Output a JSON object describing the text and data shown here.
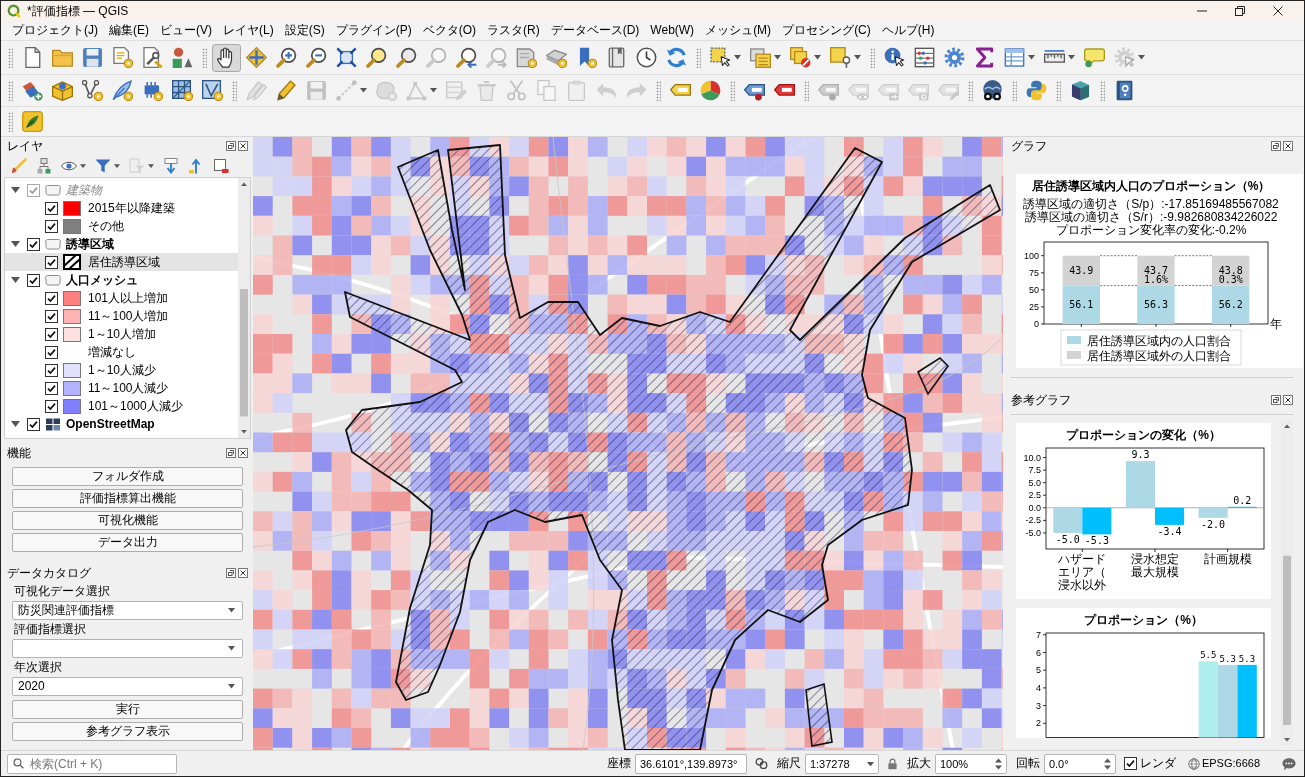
{
  "window": {
    "title": "*評価指標 — QGIS"
  },
  "menu": [
    "プロジェクト(J)",
    "編集(E)",
    "ビュー(V)",
    "レイヤ(L)",
    "設定(S)",
    "プラグイン(P)",
    "ベクタ(O)",
    "ラスタ(R)",
    "データベース(D)",
    "Web(W)",
    "メッシュ(M)",
    "プロセシング(C)",
    "ヘルプ(H)"
  ],
  "toolbars": [
    {
      "groups": [
        [
          {
            "kind": "page",
            "pressed": false,
            "disabled": false,
            "dropdown": false
          },
          {
            "kind": "folder",
            "pressed": false,
            "disabled": false,
            "dropdown": false
          },
          {
            "kind": "floppy",
            "pressed": false,
            "disabled": false,
            "dropdown": false
          },
          {
            "kind": "page-badge",
            "pressed": false,
            "disabled": false,
            "dropdown": false
          },
          {
            "kind": "page-wrench",
            "pressed": false,
            "disabled": false,
            "dropdown": false
          },
          {
            "kind": "shapes",
            "pressed": false,
            "disabled": false,
            "dropdown": false
          }
        ],
        [
          {
            "kind": "hand",
            "pressed": true,
            "disabled": false,
            "dropdown": false
          },
          {
            "kind": "move-arrows",
            "pressed": false,
            "disabled": false,
            "dropdown": false
          },
          {
            "kind": "zoom-in",
            "pressed": false,
            "disabled": false,
            "dropdown": false
          },
          {
            "kind": "zoom-out",
            "pressed": false,
            "disabled": false,
            "dropdown": false
          },
          {
            "kind": "zoom-full",
            "pressed": false,
            "disabled": false,
            "dropdown": false
          },
          {
            "kind": "zoom-selection",
            "pressed": false,
            "disabled": false,
            "dropdown": false
          },
          {
            "kind": "zoom-layer",
            "pressed": false,
            "disabled": false,
            "dropdown": false
          },
          {
            "kind": "zoom-native",
            "pressed": false,
            "disabled": true,
            "dropdown": false
          },
          {
            "kind": "zoom-last",
            "pressed": false,
            "disabled": false,
            "dropdown": false
          },
          {
            "kind": "zoom-next",
            "pressed": false,
            "disabled": true,
            "dropdown": false
          },
          {
            "kind": "map-sheet",
            "pressed": false,
            "disabled": false,
            "dropdown": false
          },
          {
            "kind": "map-tile",
            "pressed": false,
            "disabled": false,
            "dropdown": false
          },
          {
            "kind": "bookmark",
            "pressed": false,
            "disabled": false,
            "dropdown": false
          },
          {
            "kind": "book",
            "pressed": false,
            "disabled": false,
            "dropdown": false
          },
          {
            "kind": "clock",
            "pressed": false,
            "disabled": false,
            "dropdown": false
          },
          {
            "kind": "refresh",
            "pressed": false,
            "disabled": false,
            "dropdown": false
          }
        ],
        [
          {
            "kind": "select",
            "pressed": false,
            "disabled": false,
            "dropdown": true
          },
          {
            "kind": "select-table",
            "pressed": false,
            "disabled": false,
            "dropdown": true
          },
          {
            "kind": "deselect",
            "pressed": false,
            "disabled": false,
            "dropdown": true
          },
          {
            "kind": "select-location",
            "pressed": false,
            "disabled": false,
            "dropdown": true
          }
        ],
        [
          {
            "kind": "identify",
            "pressed": false,
            "disabled": false,
            "dropdown": false
          },
          {
            "kind": "abacus",
            "pressed": false,
            "disabled": false,
            "dropdown": false
          },
          {
            "kind": "gear",
            "pressed": false,
            "disabled": false,
            "dropdown": false
          },
          {
            "kind": "sigma",
            "pressed": false,
            "disabled": false,
            "dropdown": false
          },
          {
            "kind": "table",
            "pressed": false,
            "disabled": false,
            "dropdown": true
          },
          {
            "kind": "ruler",
            "pressed": false,
            "disabled": false,
            "dropdown": true
          },
          {
            "kind": "tip",
            "pressed": false,
            "disabled": false,
            "dropdown": false
          },
          {
            "kind": "gear-cursor",
            "pressed": false,
            "disabled": true,
            "dropdown": true
          }
        ]
      ]
    },
    {
      "groups": [
        [
          {
            "kind": "layers-add",
            "disabled": false,
            "dropdown": false
          },
          {
            "kind": "box",
            "disabled": false,
            "dropdown": false
          },
          {
            "kind": "vertex",
            "disabled": false,
            "dropdown": false
          },
          {
            "kind": "feather",
            "disabled": false,
            "dropdown": false
          },
          {
            "kind": "chip",
            "disabled": false,
            "dropdown": false
          },
          {
            "kind": "grid",
            "disabled": false,
            "dropdown": false
          },
          {
            "kind": "frame",
            "disabled": false,
            "dropdown": false
          }
        ],
        [
          {
            "kind": "pencils",
            "disabled": true,
            "dropdown": false
          },
          {
            "kind": "pencil",
            "disabled": false,
            "dropdown": false
          },
          {
            "kind": "floppy",
            "disabled": true,
            "dropdown": false
          },
          {
            "kind": "line",
            "disabled": true,
            "dropdown": true
          },
          {
            "kind": "polygon",
            "disabled": true,
            "dropdown": false
          },
          {
            "kind": "vertex-tool",
            "disabled": true,
            "dropdown": true
          },
          {
            "kind": "table-pencil",
            "disabled": true,
            "dropdown": false
          },
          {
            "kind": "trash",
            "disabled": true,
            "dropdown": false
          },
          {
            "kind": "scissors",
            "disabled": true,
            "dropdown": false
          },
          {
            "kind": "copy",
            "disabled": true,
            "dropdown": false
          },
          {
            "kind": "paste",
            "disabled": true,
            "dropdown": false
          },
          {
            "kind": "undo",
            "disabled": true,
            "dropdown": false
          },
          {
            "kind": "redo",
            "disabled": true,
            "dropdown": false
          }
        ],
        [
          {
            "kind": "label",
            "disabled": false,
            "dropdown": false
          },
          {
            "kind": "pie",
            "disabled": false,
            "dropdown": false
          }
        ],
        [
          {
            "kind": "label-pin",
            "disabled": false,
            "dropdown": false
          },
          {
            "kind": "label-red",
            "disabled": false,
            "dropdown": false
          }
        ],
        [
          {
            "kind": "label-pin",
            "disabled": true,
            "dropdown": false
          },
          {
            "kind": "label-eye",
            "disabled": true,
            "dropdown": false
          },
          {
            "kind": "label-move",
            "disabled": true,
            "dropdown": false
          },
          {
            "kind": "label-rotate",
            "disabled": true,
            "dropdown": false
          },
          {
            "kind": "label-edit",
            "disabled": true,
            "dropdown": false
          }
        ],
        [
          {
            "kind": "binoculars",
            "disabled": false,
            "dropdown": false
          }
        ],
        [
          {
            "kind": "snake",
            "disabled": false,
            "dropdown": false
          }
        ],
        [
          {
            "kind": "cube",
            "disabled": false,
            "dropdown": false
          }
        ],
        [
          {
            "kind": "help",
            "disabled": false,
            "dropdown": false
          }
        ]
      ]
    },
    {
      "groups": [
        [
          {
            "kind": "leaf"
          }
        ]
      ]
    }
  ],
  "layers_panel": {
    "title": "レイヤ",
    "tools": [
      {
        "kind": "brush",
        "disabled": false,
        "dropdown": false
      },
      {
        "kind": "hierarchy",
        "disabled": false,
        "dropdown": false
      },
      {
        "kind": "eye",
        "disabled": false,
        "dropdown": true
      },
      {
        "kind": "filter",
        "disabled": false,
        "dropdown": true
      },
      {
        "kind": "expression",
        "disabled": true,
        "dropdown": true
      },
      {
        "kind": "expand-all",
        "disabled": false,
        "dropdown": false
      },
      {
        "kind": "collapse-all",
        "disabled": false,
        "dropdown": false
      },
      {
        "kind": "remove",
        "disabled": false,
        "dropdown": false
      }
    ],
    "tree": [
      {
        "label": "建築物",
        "kind": "group",
        "checked": true,
        "disabled": true,
        "expanded": true,
        "selected": false,
        "children": [
          {
            "label": "2015年以降建築",
            "kind": "fill",
            "color": "#ff0000",
            "checked": true,
            "selected": false
          },
          {
            "label": "その他",
            "kind": "fill",
            "color": "#808080",
            "checked": true,
            "selected": false
          }
        ]
      },
      {
        "label": "誘導区域",
        "kind": "group",
        "checked": true,
        "disabled": false,
        "expanded": true,
        "selected": false,
        "children": [
          {
            "label": "居住誘導区域",
            "kind": "hatch",
            "checked": true,
            "selected": true
          }
        ]
      },
      {
        "label": "人口メッシュ",
        "kind": "group",
        "checked": true,
        "disabled": false,
        "expanded": true,
        "selected": false,
        "children": [
          {
            "label": "101人以上増加",
            "kind": "fill",
            "color": "#ff7f7f",
            "checked": true,
            "selected": false
          },
          {
            "label": "11～100人増加",
            "kind": "fill",
            "color": "#ffb2b2",
            "checked": true,
            "selected": false
          },
          {
            "label": "1～10人増加",
            "kind": "fill",
            "color": "#ffe0e0",
            "checked": true,
            "selected": false
          },
          {
            "label": "増減なし",
            "kind": "blank",
            "checked": true,
            "selected": false
          },
          {
            "label": "1～10人減少",
            "kind": "fill",
            "color": "#e0e0ff",
            "checked": true,
            "selected": false
          },
          {
            "label": "11～100人減少",
            "kind": "fill",
            "color": "#b2b2ff",
            "checked": true,
            "selected": false
          },
          {
            "label": "101～1000人減少",
            "kind": "fill",
            "color": "#7f7fff",
            "checked": true,
            "selected": false
          }
        ]
      },
      {
        "label": "OpenStreetMap",
        "kind": "tiles",
        "checked": true,
        "disabled": false,
        "expanded": true,
        "selected": false
      }
    ]
  },
  "functions_panel": {
    "title": "機能",
    "buttons": [
      "フォルダ作成",
      "評価指標算出機能",
      "可視化機能",
      "データ出力"
    ]
  },
  "data_catalog_panel": {
    "title": "データカタログ",
    "fields": [
      {
        "label": "可視化データ選択",
        "value": "防災関連評価指標"
      },
      {
        "label": "評価指標選択"
      },
      {
        "label": "年次選択",
        "value": "2020"
      }
    ],
    "buttons": [
      "実行",
      "参考グラフ表示"
    ]
  },
  "graph_panel": {
    "title": "グラフ",
    "notes": [
      "誘導区域の適切さ（S/p）:-17.85169485567082",
      "誘導区域の適切さ（S/r）:-9.982680834226022",
      "プロポーション変化率の変化:-0.2%"
    ],
    "chart_data": {
      "type": "bar",
      "title": "居住誘導区域内人口のプロポーション（%）",
      "xlabel": "年",
      "stacked": true,
      "data_labels": true,
      "ylim": [
        0,
        120
      ],
      "yticks": [
        0,
        25,
        50,
        75,
        100
      ],
      "legend": "lower center",
      "series": [
        {
          "name": "居住誘導区域内の人口割合",
          "color": "#add8e6",
          "values": [
            56.1,
            56.3,
            56.2
          ]
        },
        {
          "name": "居住誘導区域外の人口割合",
          "color": "#d3d3d3",
          "values": [
            43.9,
            43.7,
            43.8
          ]
        }
      ],
      "annotations": [
        "1.6%",
        "0.3%"
      ]
    }
  },
  "reference_graph_panel": {
    "title": "参考グラフ",
    "charts": [
      {
        "chart_data": {
          "type": "bar",
          "title": "プロポーションの変化（%）",
          "categories": [
            "ハザードエリア（浸水以外",
            "浸水想定最大規模",
            "計画規模"
          ],
          "ylim": [
            -8.2,
            11.9
          ],
          "yticks": [
            {
              "value": -5,
              "label": "-5.0"
            },
            -2.5,
            {
              "value": 0,
              "label": "0.0"
            },
            2.5,
            {
              "value": 5,
              "label": "5.0"
            },
            7.5,
            {
              "value": 10,
              "label": "10.0"
            }
          ],
          "series": [
            {
              "color": "#add8e6",
              "values": [
                -5.0,
                9.3,
                -2.0
              ],
              "value_labels": [
                "-5.0",
                "9.3",
                "-2.0"
              ]
            },
            {
              "color": "#00bfff",
              "values": [
                -5.3,
                -3.4,
                0.2
              ],
              "value_labels": [
                "-5.3",
                "-3.4",
                "0.2"
              ]
            }
          ]
        }
      },
      {
        "chart_data": {
          "type": "bar",
          "title": "プロポーション（%）",
          "data_labels": true,
          "ylim": [
            1.2,
            7.1
          ],
          "yticks": [
            2,
            3,
            4,
            5,
            6,
            7
          ],
          "series": [
            {
              "color": "#afeeee",
              "values": [
                null,
                null,
                5.5
              ]
            },
            {
              "color": "#add8e6",
              "values": [
                null,
                null,
                5.3
              ]
            },
            {
              "color": "#00bfff",
              "values": [
                null,
                null,
                5.3
              ]
            }
          ]
        }
      }
    ]
  },
  "status_bar": {
    "search": {
      "placeholder": "検索(Ctrl + K)"
    },
    "coordinate": {
      "label": "座標",
      "value": "36.6101°,139.8973°"
    },
    "scale": {
      "label": "縮尺",
      "value": "1:37278"
    },
    "magnifier": {
      "label": "拡大",
      "value": "100%"
    },
    "rotation": {
      "label": "回転",
      "value": "0.0°"
    },
    "render": {
      "label": "レンダ",
      "checked": true
    },
    "crs": "EPSG:6668"
  }
}
